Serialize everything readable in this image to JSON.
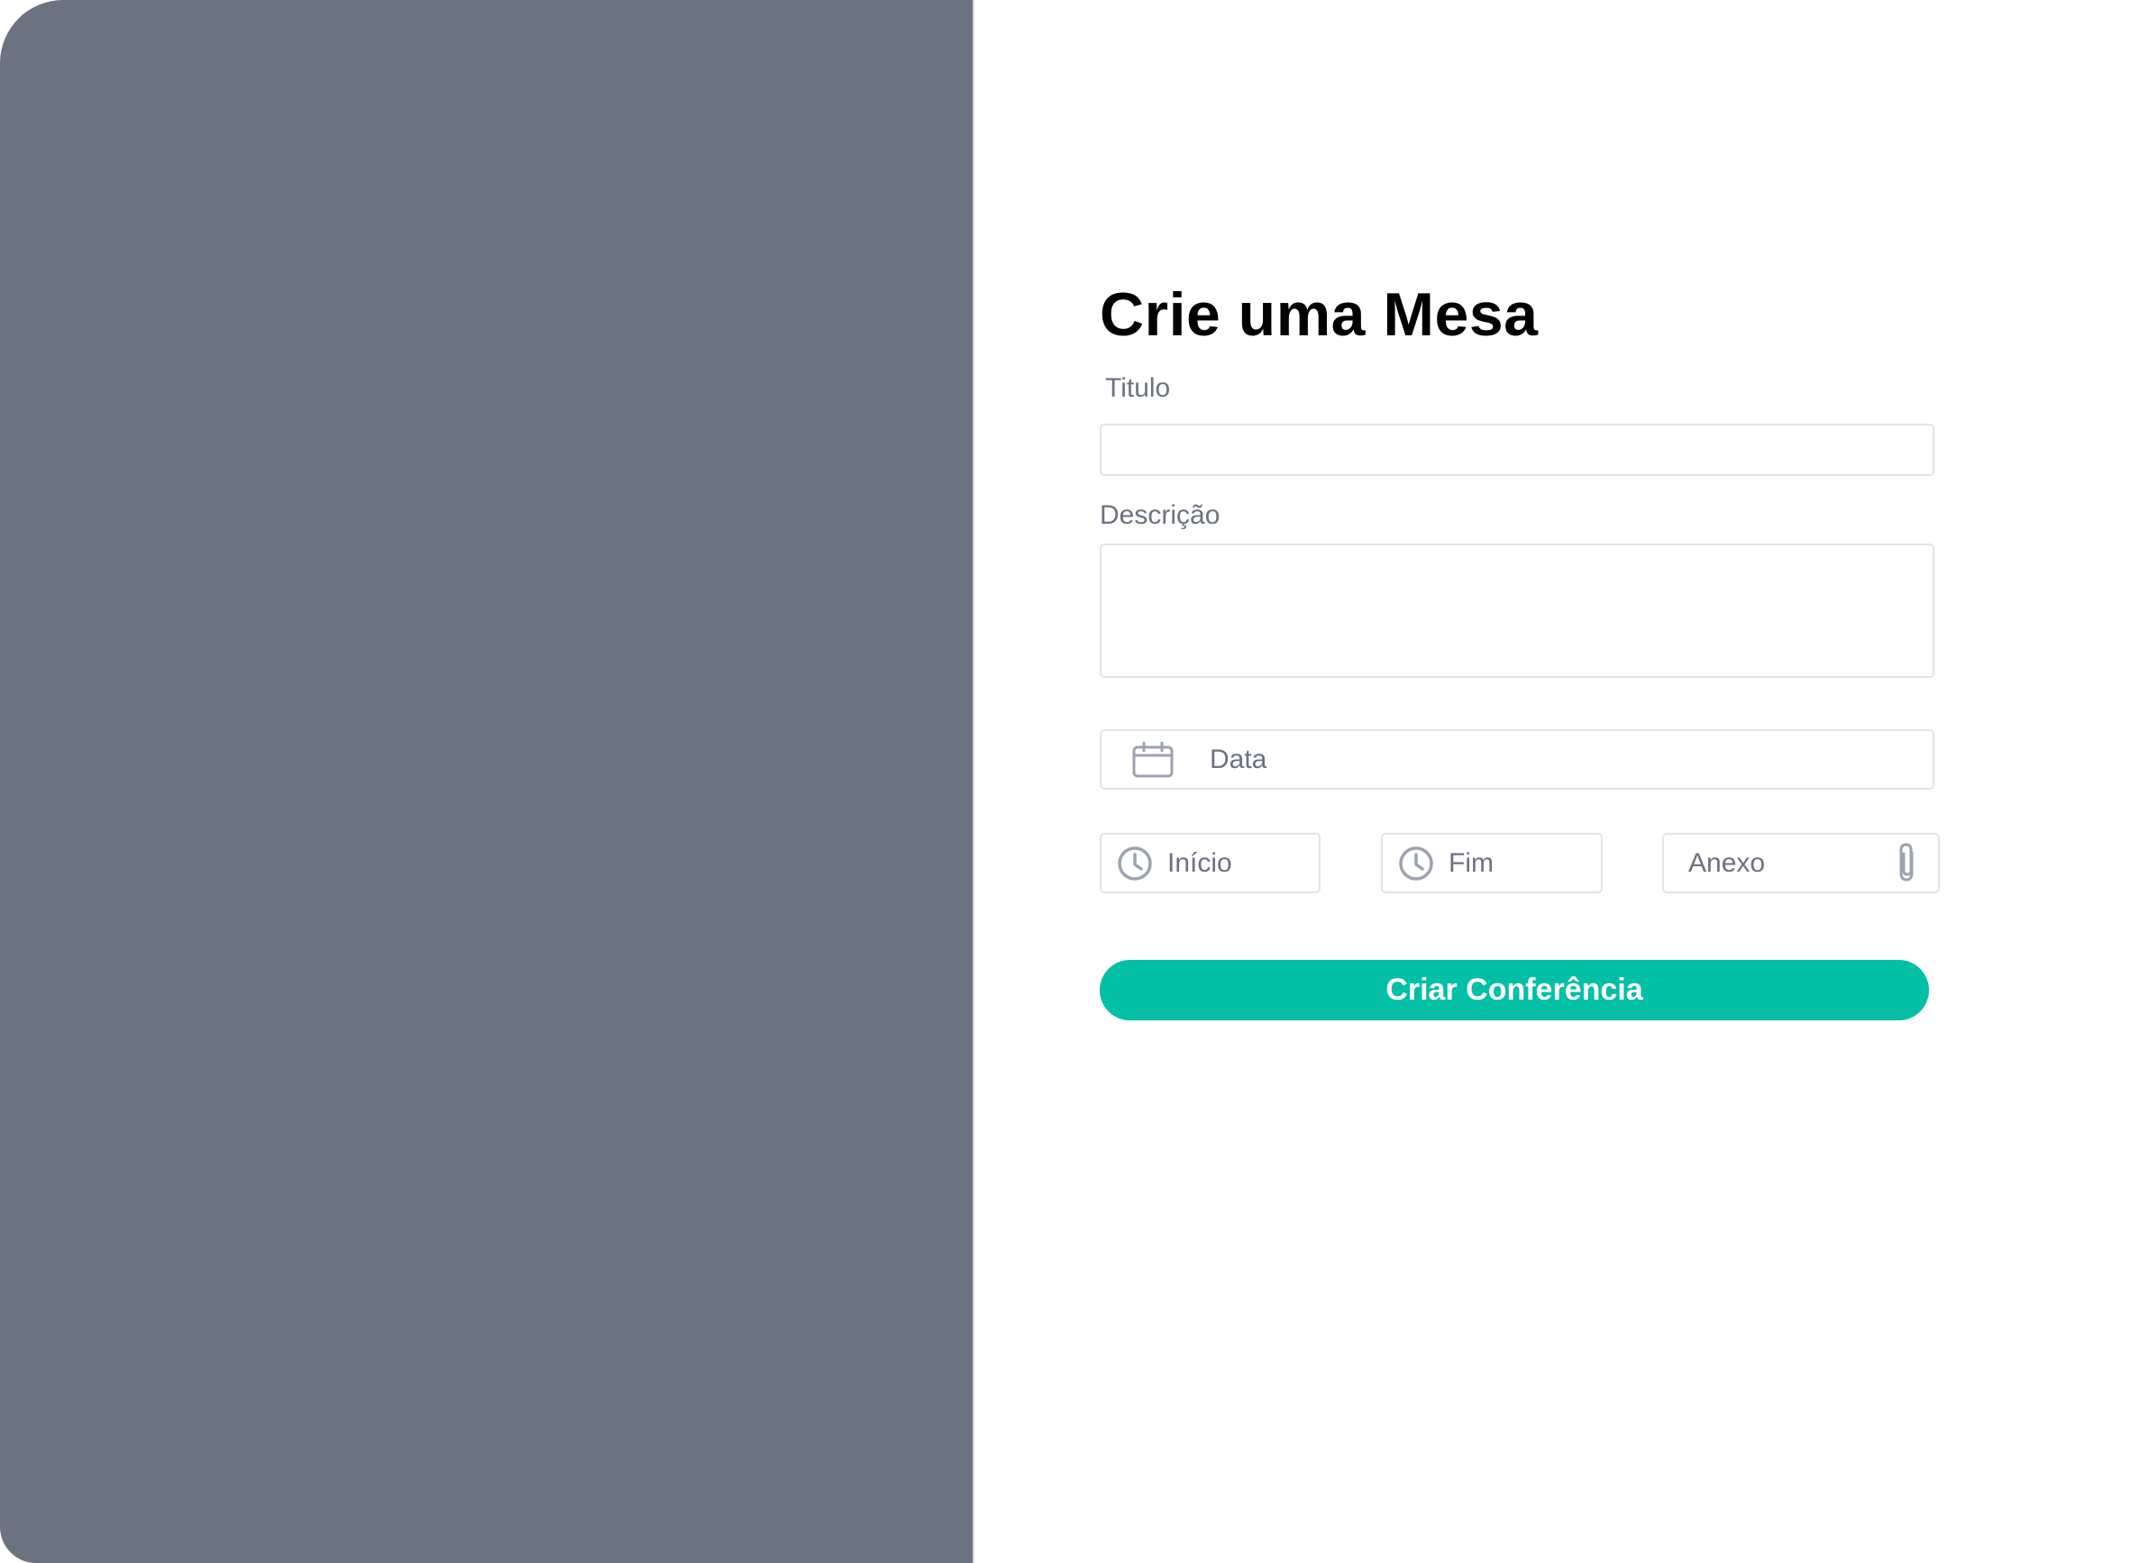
{
  "form": {
    "title": "Crie uma Mesa",
    "titulo_label": "Titulo",
    "titulo_value": "",
    "descricao_label": "Descrição",
    "descricao_value": "",
    "date_placeholder": "Data",
    "start_placeholder": "Início",
    "end_placeholder": "Fim",
    "attachment_placeholder": "Anexo",
    "submit_label": "Criar Conferência"
  },
  "icons": {
    "date": "calendar-icon",
    "start": "clock-icon",
    "end": "clock-icon",
    "attachment": "paperclip-icon"
  },
  "colors": {
    "left_panel": "#6b7280",
    "accent": "#03bfa5",
    "border": "#e2e4e8",
    "muted_text": "#6b7280",
    "icon": "#9ca3af"
  }
}
